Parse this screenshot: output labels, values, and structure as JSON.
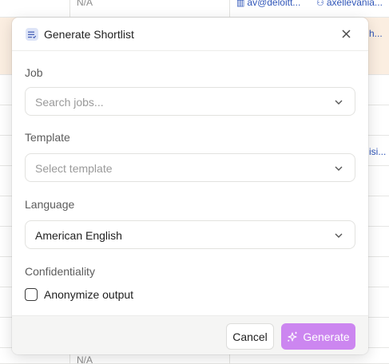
{
  "background": {
    "top_cell": "N/A",
    "email_link": "av@deloitt...",
    "user_link": "axellevania...",
    "link_right_1": "h...",
    "link_right_2": "isi...",
    "bottom_cell": "N/A"
  },
  "modal": {
    "title": "Generate Shortlist",
    "job": {
      "label": "Job",
      "placeholder": "Search jobs..."
    },
    "template": {
      "label": "Template",
      "placeholder": "Select template"
    },
    "language": {
      "label": "Language",
      "value": "American English"
    },
    "confidentiality": {
      "label": "Confidentiality",
      "checkbox_label": "Anonymize output",
      "checked": false
    },
    "footer": {
      "cancel_label": "Cancel",
      "generate_label": "Generate"
    }
  },
  "colors": {
    "accent": "#cc86f0",
    "highlight_row": "#fbeee1",
    "link": "#2f55b8"
  }
}
